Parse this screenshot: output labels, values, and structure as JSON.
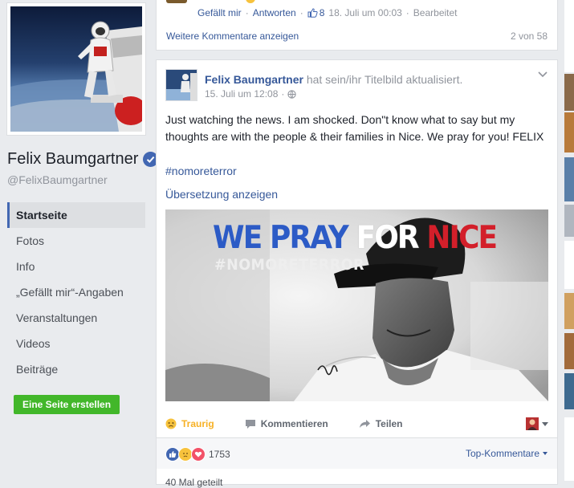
{
  "profile": {
    "name": "Felix Baumgartner",
    "handle": "@FelixBaumgartner"
  },
  "nav": {
    "items": [
      "Startseite",
      "Fotos",
      "Info",
      "„Gefällt mir“-Angaben",
      "Veranstaltungen",
      "Videos",
      "Beiträge"
    ],
    "create_page": "Eine Seite erstellen"
  },
  "comment": {
    "like": "Gefällt mir",
    "reply": "Antworten",
    "likes": "8",
    "time": "18. Juli um 00:03",
    "edited": "Bearbeitet",
    "more": "Weitere Kommentare anzeigen",
    "count": "2 von 58"
  },
  "post": {
    "author": "Felix Baumgartner",
    "action": "hat sein/ihr Titelbild aktualisiert.",
    "time": "15. Juli um 12:08",
    "text": "Just watching the news. I am shocked. Don\"t know what to say but my thoughts are with the people & their families in Nice. We pray for you! FELIX",
    "hashtag": "#nomoreterror",
    "translate": "Übersetzung anzeigen",
    "image_title": {
      "we": "WE PRAY",
      "for": "FOR",
      "nice": "NICE"
    },
    "image_tag": "#NOMORETERROR",
    "actions": {
      "reaction": "Traurig",
      "comment": "Kommentieren",
      "share": "Teilen"
    },
    "reaction_count": "1753",
    "top_comments": "Top-Kommentare",
    "shares": "40 Mal geteilt"
  },
  "colors": {
    "link": "#365899",
    "sad": "#f7b125",
    "create_button": "#42b72a"
  }
}
